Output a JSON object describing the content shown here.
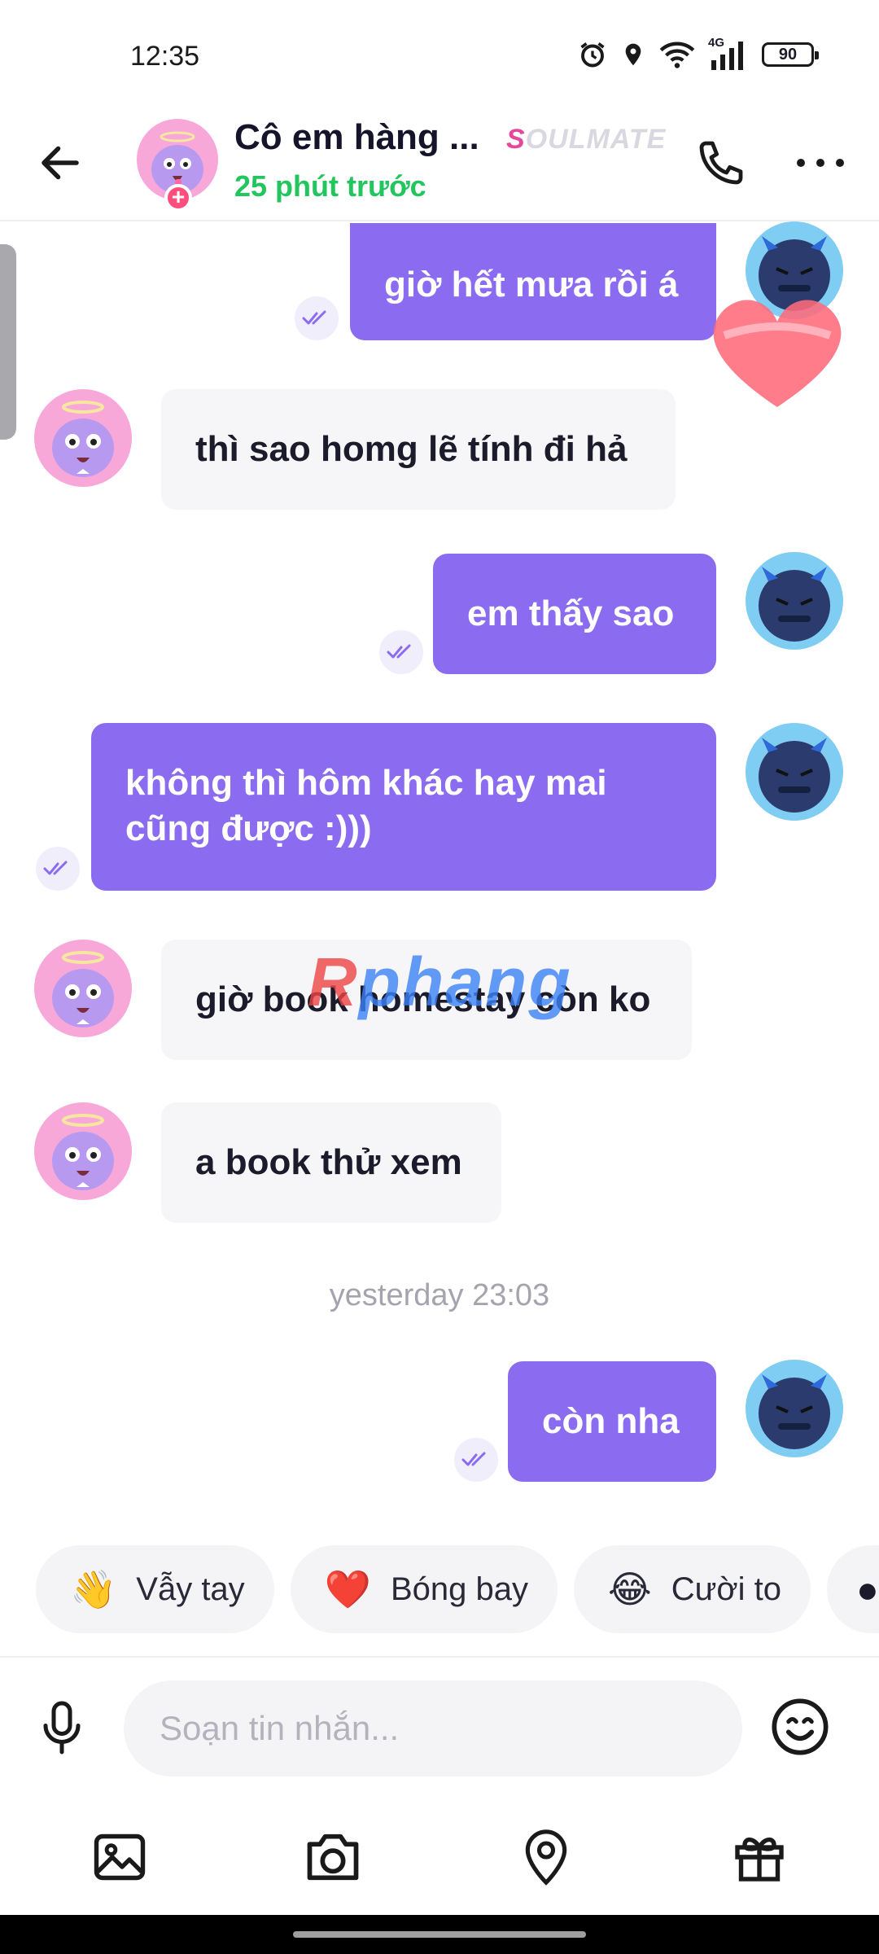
{
  "status_bar": {
    "time": "12:35",
    "network": "4G",
    "battery": "90",
    "icons": [
      "alarm-icon",
      "location-icon",
      "wifi-icon",
      "signal-icon",
      "battery-icon"
    ]
  },
  "header": {
    "contact_name": "Cô em hàng ...",
    "last_seen": "25 phút trước",
    "badge_first": "S",
    "badge_rest": "OULMATE",
    "online_color": "#22c55e"
  },
  "messages": [
    {
      "direction": "out",
      "text": "giờ hết mưa rồi á"
    },
    {
      "direction": "in",
      "text": "thì sao homg lẽ tính đi hả"
    },
    {
      "direction": "out",
      "text": "em thấy sao"
    },
    {
      "direction": "out",
      "text_line1": "không thì hôm khác hay mai",
      "text_line2": "cũng được :)))"
    },
    {
      "direction": "in",
      "text": "giờ book homestay còn ko"
    },
    {
      "direction": "in",
      "text": "a book thử xem"
    },
    {
      "direction": "out",
      "text": "còn nha"
    }
  ],
  "date_separator": "yesterday 23:03",
  "watermark": {
    "first": "R",
    "rest": "phang"
  },
  "quick_reactions": [
    {
      "emoji": "👋",
      "label": "Vẫy tay"
    },
    {
      "emoji": "❤️",
      "label": "Bóng bay"
    },
    {
      "emoji": "😂",
      "label": "Cười to"
    }
  ],
  "composer": {
    "placeholder": "Soạn tin nhắn..."
  },
  "toolbar": [
    "image-icon",
    "camera-icon",
    "location-pin-icon",
    "gift-icon"
  ],
  "colors": {
    "outgoing_bubble": "#8b6cf0",
    "incoming_bubble": "#f6f6f8",
    "accent_pink": "#e5479a"
  }
}
